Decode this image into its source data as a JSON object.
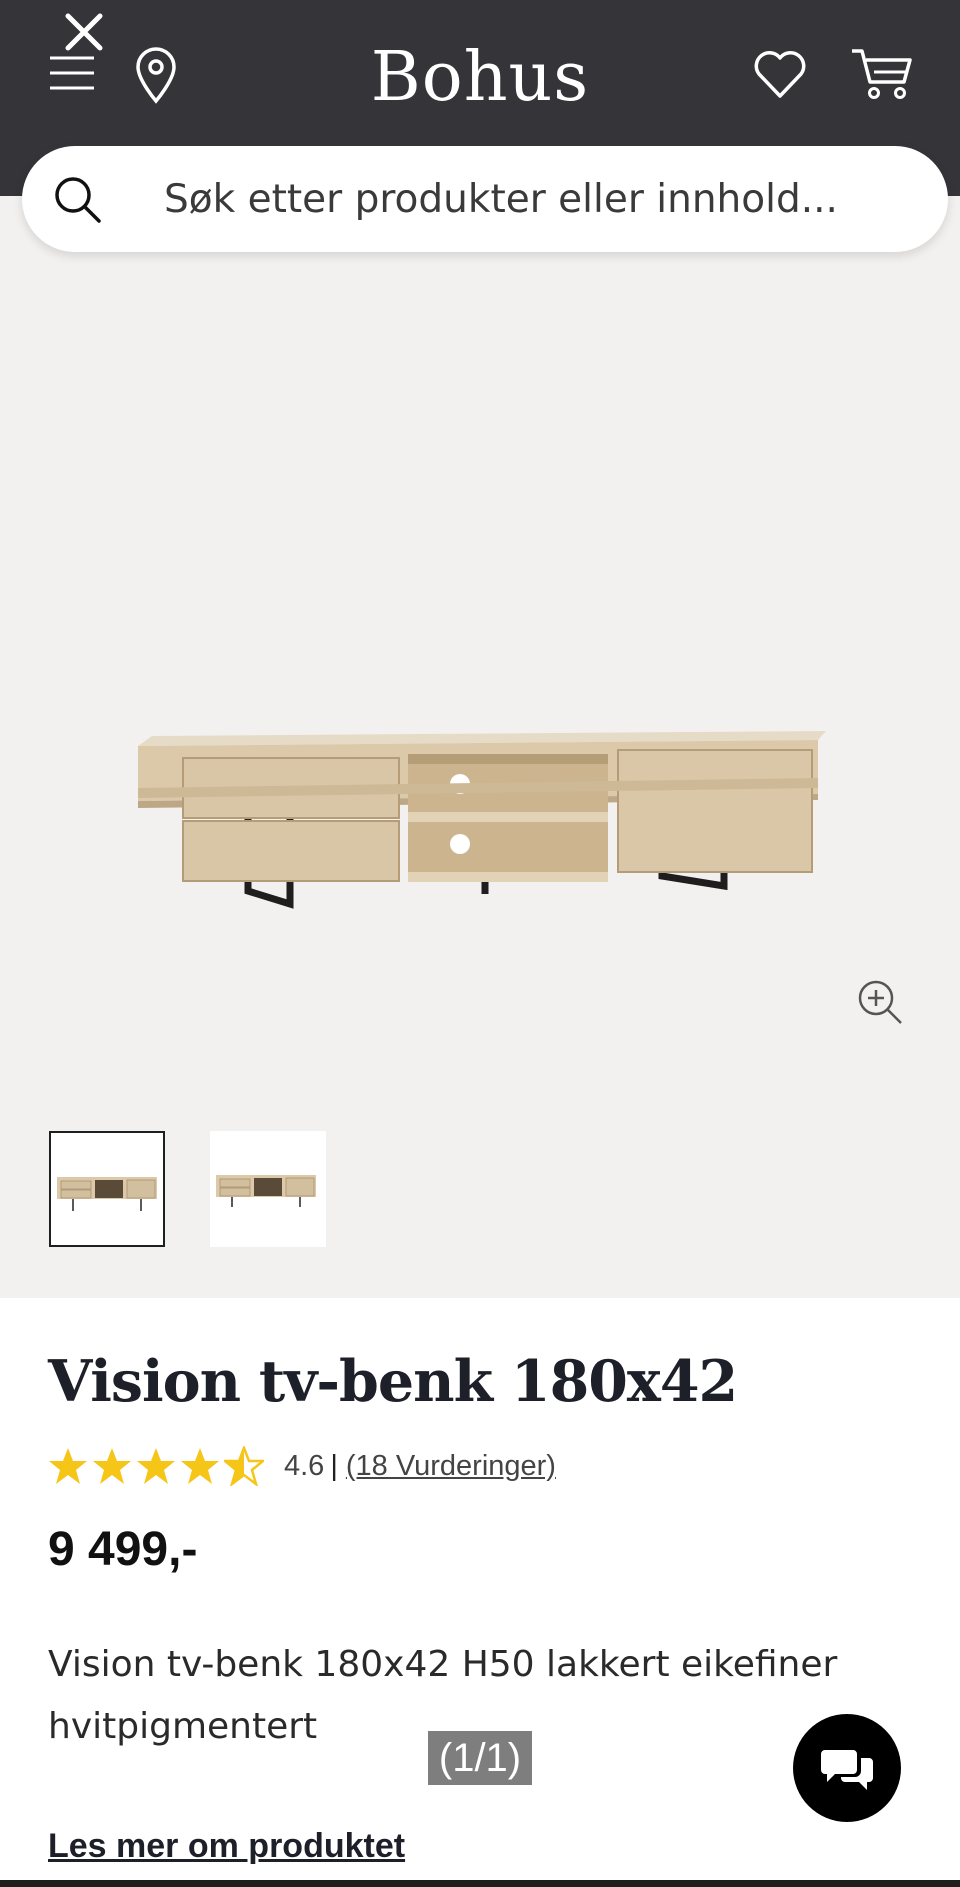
{
  "header": {
    "brand": "Bohus"
  },
  "icons": {
    "close": "close-icon",
    "menu": "menu-icon",
    "store_locator": "location-pin-icon",
    "wishlist": "heart-icon",
    "cart": "cart-icon",
    "search": "search-icon",
    "zoom": "zoom-in-icon",
    "chat": "chat-icon"
  },
  "search": {
    "placeholder": "Søk etter produkter eller innhold..."
  },
  "gallery": {
    "thumbnail_count": 2,
    "selected_thumbnail": 1
  },
  "product": {
    "title": "Vision tv-benk 180x42",
    "rating_value": "4.6",
    "rating_max": 5,
    "rating_separator": "|",
    "rating_count": "(18 Vurderinger)",
    "price": "9 499,-",
    "description": "Vision tv-benk 180x42 H50 lakkert eikefiner hvitpigmentert",
    "read_more": "Les mer om produktet"
  },
  "overlay": {
    "counter": "(1/1)"
  },
  "colors": {
    "header_bg": "#353438",
    "gallery_bg": "#f3f1ef",
    "star": "#f5c518",
    "chat_bg": "#000000"
  }
}
